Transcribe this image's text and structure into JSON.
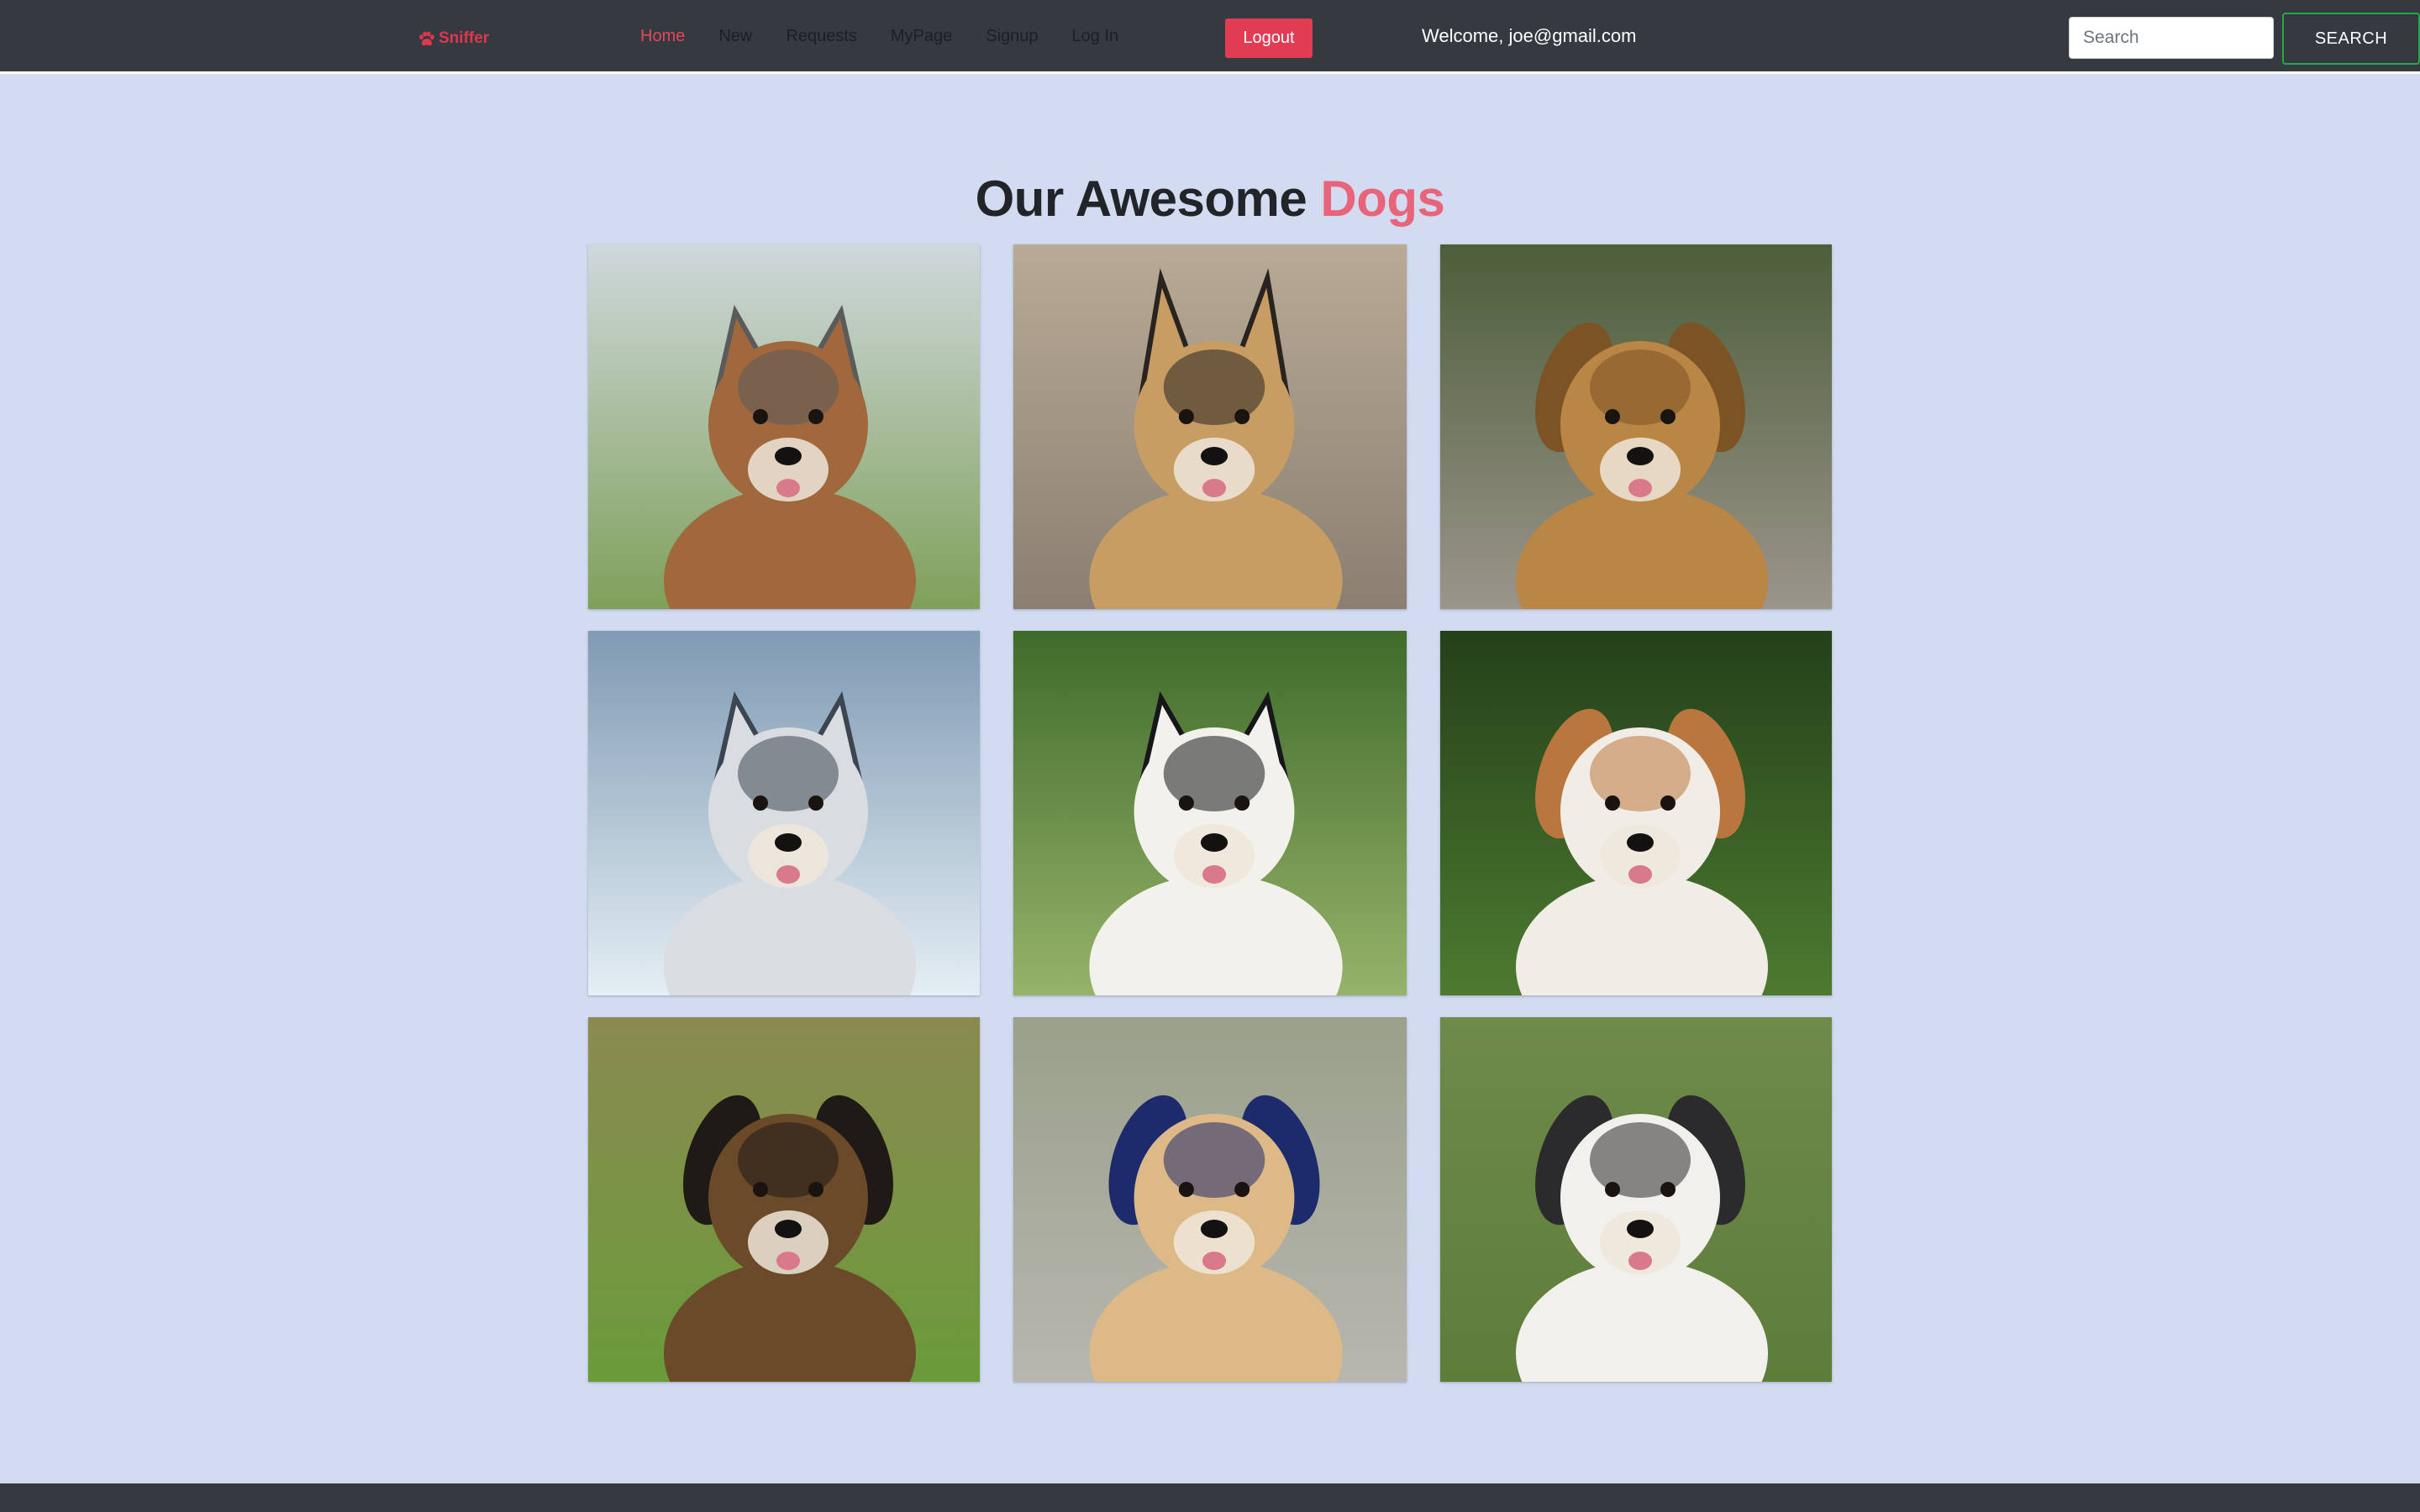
{
  "navbar": {
    "brand": "Sniffer",
    "links": [
      {
        "label": "Home",
        "active": true
      },
      {
        "label": "New",
        "active": false
      },
      {
        "label": "Requests",
        "active": false
      },
      {
        "label": "MyPage",
        "active": false
      },
      {
        "label": "Signup",
        "active": false
      },
      {
        "label": "Log In",
        "active": false
      }
    ],
    "logout_label": "Logout",
    "welcome_text": "Welcome, joe@gmail.com",
    "search_placeholder": "Search",
    "search_button_label": "SEARCH"
  },
  "main": {
    "heading_main": "Our Awesome",
    "heading_accent": "Dogs"
  },
  "colors": {
    "background": "#d3dbf1",
    "navbar": "#343a40",
    "accent": "#e8647a",
    "logout": "#e23c55",
    "search_border": "#28a745"
  },
  "gallery": [
    {
      "photo": "yorkshire-terrier-photo",
      "bg": [
        "#cfd8dc",
        "#7fa05a"
      ],
      "coat": "#a0683c",
      "accent": "#5b5b5b",
      "ears": "pointed"
    },
    {
      "photo": "german-shepherd-puppy-photo",
      "bg": [
        "#b9aa95",
        "#8a7f72"
      ],
      "coat": "#c89d63",
      "accent": "#2a2420",
      "ears": "tall"
    },
    {
      "photo": "golden-retriever-puppy-photo",
      "bg": [
        "#4d5e3a",
        "#9b958b"
      ],
      "coat": "#b98645",
      "accent": "#7c5324",
      "ears": "floppy"
    },
    {
      "photo": "siberian-husky-photo",
      "bg": [
        "#7f9ab3",
        "#e4eef4"
      ],
      "coat": "#d9dde1",
      "accent": "#3c4652",
      "ears": "pointed"
    },
    {
      "photo": "border-collie-photo",
      "bg": [
        "#3f6b2a",
        "#97b36a"
      ],
      "coat": "#f3f1ec",
      "accent": "#15171a",
      "ears": "pointed"
    },
    {
      "photo": "jack-russell-puppy-photo",
      "bg": [
        "#24411a",
        "#4d7a30"
      ],
      "coat": "#f1ede6",
      "accent": "#b9763e",
      "ears": "floppy"
    },
    {
      "photo": "mixed-breed-dog-photo",
      "bg": [
        "#8a8a50",
        "#6a9b3a"
      ],
      "coat": "#6b4a2a",
      "accent": "#1f1a15",
      "ears": "floppy"
    },
    {
      "photo": "golden-retriever-puppy-collar-photo",
      "bg": [
        "#9aa08a",
        "#b8b6b0"
      ],
      "coat": "#ddb987",
      "accent": "#1d2a6b",
      "ears": "floppy"
    },
    {
      "photo": "australian-shepherd-photo",
      "bg": [
        "#6f8a4a",
        "#5d7d3a"
      ],
      "coat": "#f2f0ec",
      "accent": "#2b2b2e",
      "ears": "floppy"
    }
  ]
}
